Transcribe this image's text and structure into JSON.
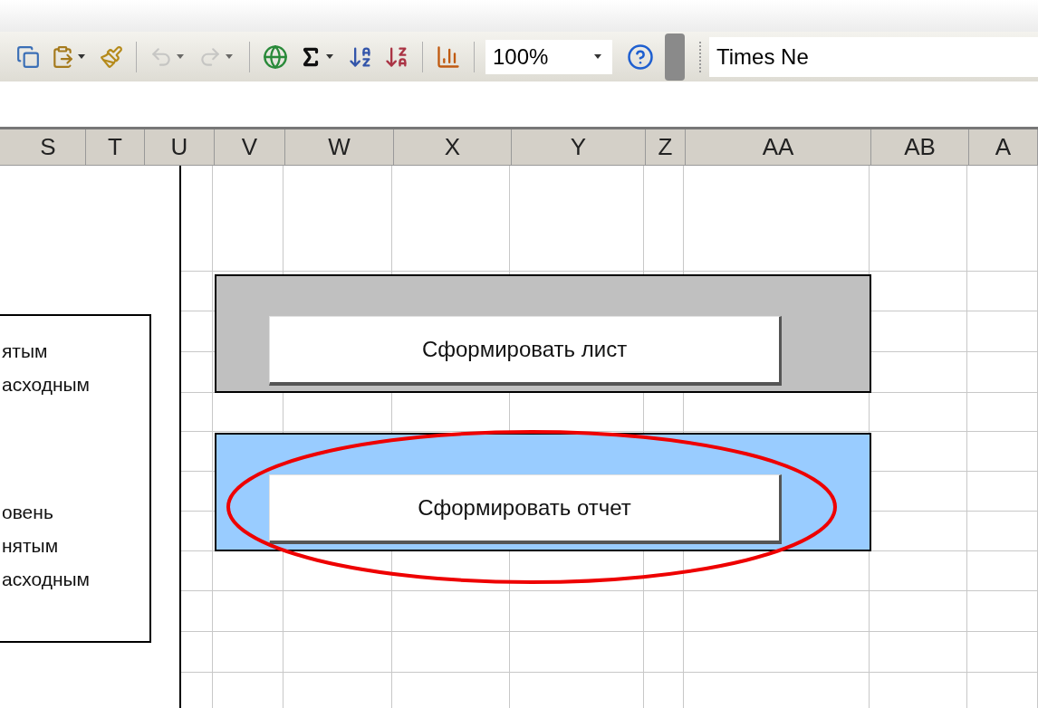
{
  "toolbar": {
    "buttons": [
      {
        "kind": "copy",
        "dropdown": false,
        "disabled": false
      },
      {
        "kind": "paste",
        "dropdown": true,
        "disabled": false
      },
      {
        "kind": "painter",
        "dropdown": false,
        "disabled": false
      },
      {
        "kind": "separator"
      },
      {
        "kind": "undo",
        "dropdown": true,
        "disabled": true
      },
      {
        "kind": "redo",
        "dropdown": true,
        "disabled": true
      },
      {
        "kind": "separator"
      },
      {
        "kind": "link",
        "dropdown": false,
        "disabled": false
      },
      {
        "kind": "sum",
        "dropdown": true,
        "disabled": false
      },
      {
        "kind": "sort-asc",
        "dropdown": false,
        "disabled": false
      },
      {
        "kind": "sort-desc",
        "dropdown": false,
        "disabled": false
      },
      {
        "kind": "separator"
      },
      {
        "kind": "chart",
        "dropdown": false,
        "disabled": false
      }
    ],
    "zoom": {
      "value": "100%"
    },
    "font": {
      "value": "Times Ne"
    }
  },
  "columns": [
    "S",
    "T",
    "U",
    "V",
    "W",
    "X",
    "Y",
    "Z",
    "AA",
    "AB",
    "A"
  ],
  "text_box": {
    "paragraphs": [
      [
        "ятым",
        "асходным"
      ],
      [
        "овень",
        "нятым",
        "асходным"
      ]
    ]
  },
  "panels": [
    {
      "color": "#c0c0c0",
      "button": "Сформировать лист",
      "highlighted": false
    },
    {
      "color": "#99ccff",
      "button": "Сформировать отчет",
      "highlighted": true
    }
  ]
}
